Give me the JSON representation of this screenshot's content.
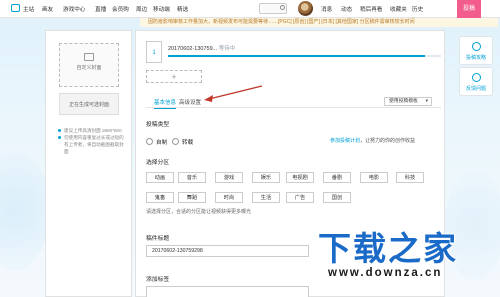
{
  "topnav": {
    "home": "主站",
    "items": [
      "画友",
      "游戏中心",
      "直播",
      "会员购",
      "周边",
      "移动端",
      "精选"
    ],
    "right_items": [
      "消息",
      "动态",
      "稍后再看",
      "收藏夹",
      "历史"
    ],
    "post_button": "投稿"
  },
  "notice": "因防疫影响审核工作量加大，新视频发布可能需要等待……[PGC] [原创] [国产] [日本] [其他国家] 分区稿件需审核较长时间",
  "left_panel": {
    "cover_upload_label": "自定义封面",
    "cover_generating": "正在生成可选封面",
    "tips": [
      "建议上传高清封面 ≥960*600",
      "勿使用内容重复过长或过短的有上传者，将自动截图截取封面"
    ]
  },
  "upload": {
    "index": "1",
    "file_name": "20170602-130759...",
    "status": "等待中",
    "progress": 0.94,
    "add_button": "+"
  },
  "tabs": [
    "基本信息",
    "高级设置"
  ],
  "template_button": "使用投稿模板",
  "type_section": {
    "title": "投稿类型",
    "options": [
      "自制",
      "转载"
    ],
    "tip_prefix": "",
    "tip_link": "参加投稿计划",
    "tip_suffix": "，让努力的你的创作收益"
  },
  "category_section": {
    "title": "选择分区",
    "rows": [
      [
        "动画",
        "音乐",
        "游戏",
        "娱乐",
        "电视剧",
        "番剧",
        "电影",
        "科技"
      ],
      [
        "鬼畜",
        "舞蹈",
        "时尚",
        "生活",
        "广告",
        "国创"
      ]
    ],
    "note": "请选择分区，合适的分区能让视频获得更多曝光"
  },
  "title_section": {
    "title": "稿件标题",
    "value": "20170602-130759298"
  },
  "tags_section": {
    "title": "添加标签"
  },
  "side_buttons": [
    "投稿攻略",
    "反馈问题"
  ],
  "watermark": {
    "title": "下载之家",
    "url": "www.downza.cn"
  },
  "colors": {
    "accent": "#00a1d6",
    "pink": "#f25d8e",
    "watermark_blue": "#1a6ac8"
  }
}
